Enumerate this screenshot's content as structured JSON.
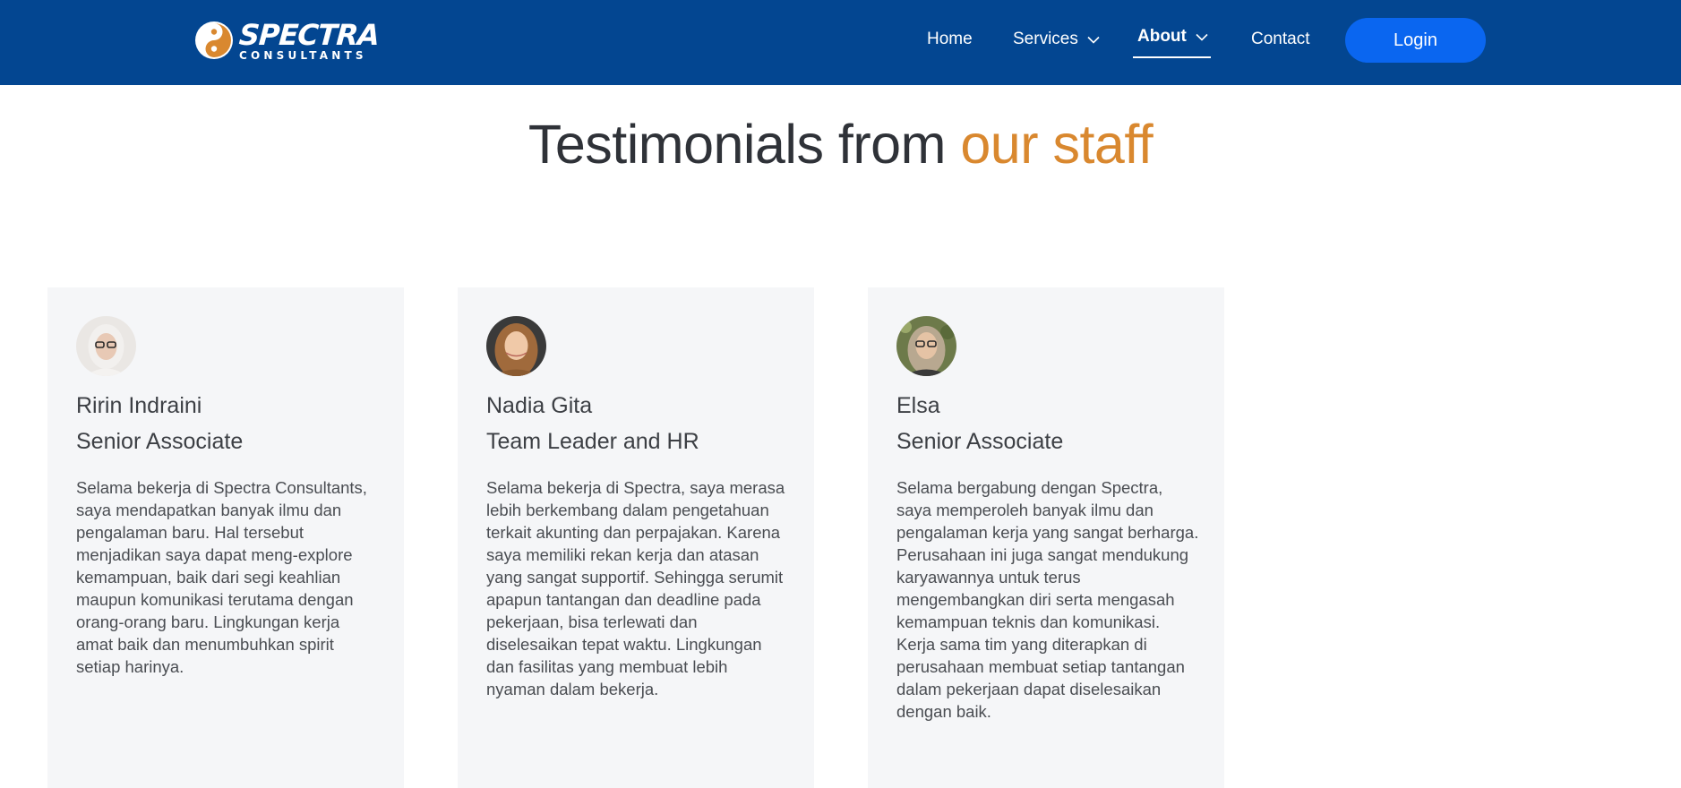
{
  "brand": {
    "name": "SPECTRA",
    "tagline": "CONSULTANTS",
    "primary_color": "#034691",
    "accent_color": "#d9882f",
    "button_color": "#0a66f0"
  },
  "nav": {
    "home": "Home",
    "services": "Services",
    "about": "About",
    "contact": "Contact",
    "login": "Login"
  },
  "heading": {
    "main": "Testimonials from ",
    "accent": "our staff"
  },
  "testimonials": [
    {
      "name": "Ririn Indraini",
      "role": "Senior Associate",
      "text": "Selama bekerja di Spectra Consultants, saya mendapatkan banyak ilmu dan pengalaman baru. Hal tersebut menjadikan saya dapat meng-explore kemampuan, baik dari segi keahlian maupun komunikasi terutama dengan orang-orang baru. Lingkungan kerja amat baik dan menumbuhkan spirit setiap harinya."
    },
    {
      "name": "Nadia Gita",
      "role": "Team Leader and HR",
      "text": "Selama bekerja di Spectra, saya merasa lebih berkembang dalam pengetahuan terkait akunting dan perpajakan. Karena saya memiliki rekan kerja dan atasan yang sangat supportif. Sehingga serumit apapun tantangan dan deadline pada pekerjaan, bisa terlewati dan diselesaikan tepat waktu. Lingkungan dan fasilitas yang membuat lebih nyaman dalam bekerja."
    },
    {
      "name": "Elsa",
      "role": "Senior Associate",
      "text": "Selama bergabung dengan Spectra, saya memperoleh banyak ilmu dan pengalaman kerja yang sangat berharga. Perusahaan ini juga sangat mendukung karyawannya untuk terus mengembangkan diri serta mengasah kemampuan teknis dan komunikasi. Kerja sama tim yang diterapkan di perusahaan membuat setiap tantangan dalam pekerjaan dapat diselesaikan dengan baik."
    }
  ]
}
